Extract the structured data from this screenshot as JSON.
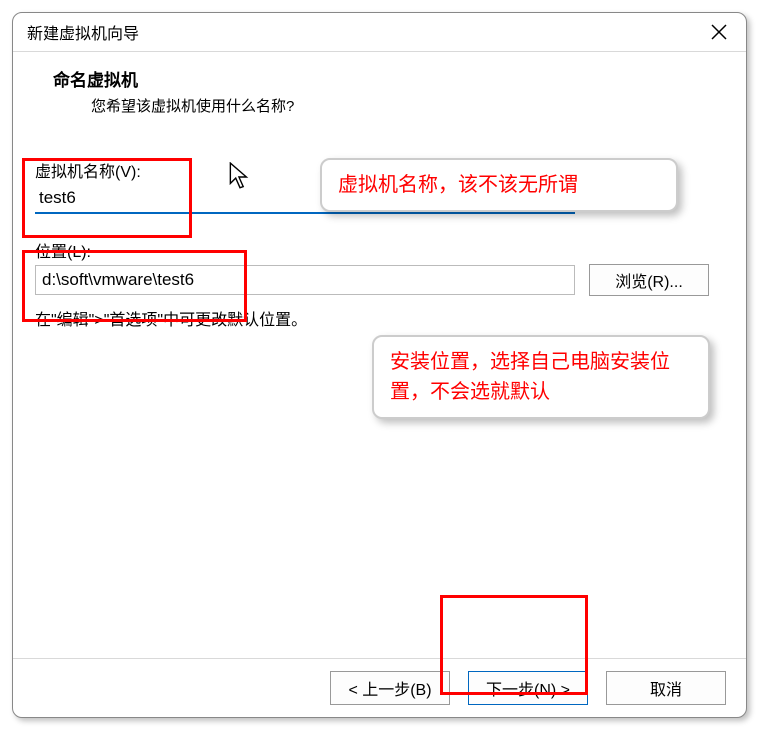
{
  "dialog": {
    "title": "新建虚拟机向导"
  },
  "header": {
    "title": "命名虚拟机",
    "subtitle": "您希望该虚拟机使用什么名称?"
  },
  "fields": {
    "name_label": "虚拟机名称(V):",
    "name_value": "test6",
    "location_label": "位置(L):",
    "location_value": "d:\\soft\\vmware\\test6",
    "browse_label": "浏览(R)..."
  },
  "hint": "在\"编辑\">\"首选项\"中可更改默认位置。",
  "annotations": {
    "callout1": "虚拟机名称，该不该无所谓",
    "callout2": "安装位置，选择自己电脑安装位置，不会选就默认"
  },
  "footer": {
    "back": "< 上一步(B)",
    "next": "下一步(N) >",
    "cancel": "取消"
  }
}
